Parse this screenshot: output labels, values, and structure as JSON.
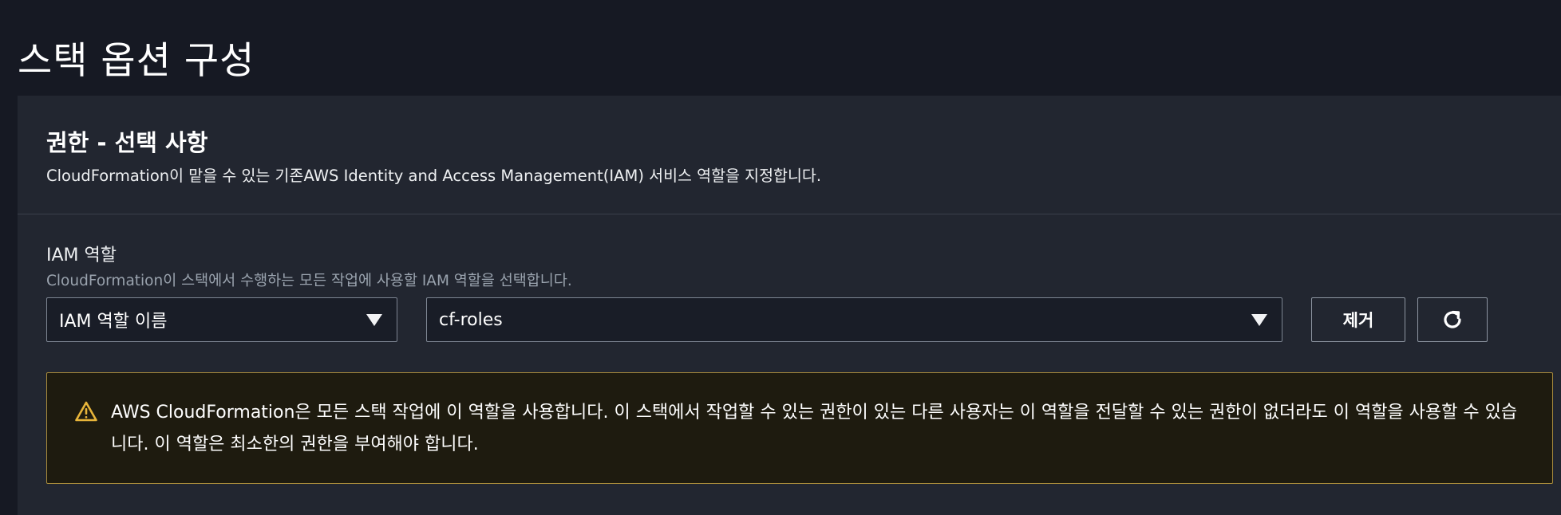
{
  "page": {
    "title": "스택 옵션 구성"
  },
  "permissions": {
    "title": "권한 - 선택 사항",
    "description": "CloudFormation이 맡을 수 있는 기존AWS Identity and Access Management(IAM) 서비스 역할을 지정합니다."
  },
  "iam_role": {
    "label": "IAM 역할",
    "description": "CloudFormation이 스택에서 수행하는 모든 작업에 사용할 IAM 역할을 선택합니다.",
    "type_select": {
      "value": "IAM 역할 이름",
      "icon": "caret-down-icon"
    },
    "role_select": {
      "value": "cf-roles",
      "icon": "caret-down-icon"
    },
    "remove_label": "제거",
    "refresh_icon": "refresh-icon"
  },
  "alert": {
    "icon": "warning-icon",
    "text": "AWS CloudFormation은 모든 스택 작업에 이 역할을 사용합니다. 이 스택에서 작업할 수 있는 권한이 있는 다른 사용자는 이 역할을 전달할 수 있는 권한이 없더라도 이 역할을 사용할 수 있습니다. 이 역할은 최소한의 권한을 부여해야 합니다."
  },
  "colors": {
    "background": "#161923",
    "panel": "#222630",
    "input_bg": "#191d27",
    "alert_bg": "#1e1b0f",
    "alert_border": "#a88b3c",
    "warning_icon": "#e8b53a"
  }
}
